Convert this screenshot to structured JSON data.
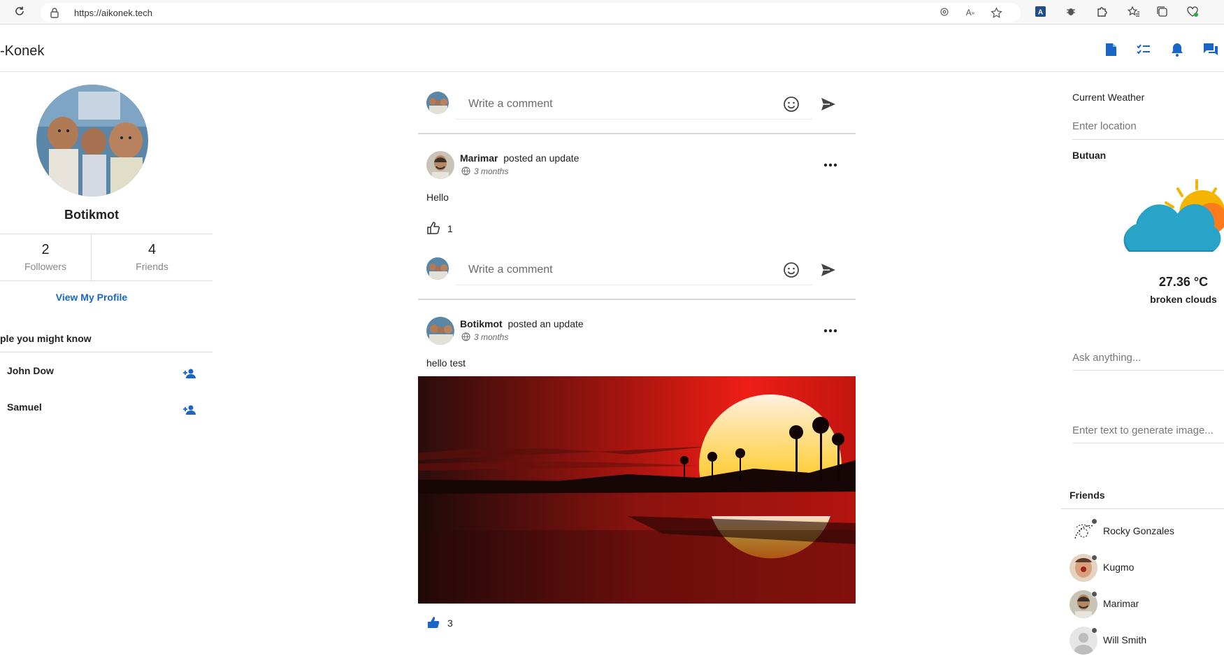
{
  "browser": {
    "url": "https://aikonek.tech",
    "icons": [
      "reload-icon",
      "lock-icon",
      "location-icon",
      "read-aloud-icon",
      "favorite-star-icon",
      "extension-icon",
      "bug-icon",
      "puzzle-icon",
      "favorites-icon",
      "collections-icon",
      "performance-icon"
    ]
  },
  "app": {
    "brand": "-Konek",
    "header_icons": [
      "document-icon",
      "task-list-icon",
      "bell-icon",
      "chat-icon"
    ],
    "accent": "#1a66c8"
  },
  "profile": {
    "name": "Botikmot",
    "followers_count": "2",
    "followers_label": "Followers",
    "friends_count": "4",
    "friends_label": "Friends",
    "view_profile": "View My Profile"
  },
  "pymk": {
    "title": "ple you might know",
    "people": [
      {
        "name": "John Dow"
      },
      {
        "name": "Samuel"
      }
    ]
  },
  "feed": {
    "comment_placeholder": "Write a comment",
    "posts": [
      {
        "author": "Marimar",
        "action": "posted an update",
        "time": "3 months",
        "text": "Hello",
        "likes": "1"
      },
      {
        "author": "Botikmot",
        "action": "posted an update",
        "time": "3 months",
        "text": "hello test",
        "likes": "3"
      }
    ]
  },
  "sidebar": {
    "weather_title": "Current Weather",
    "location_placeholder": "Enter location",
    "city": "Butuan",
    "temperature": "27.36 °C",
    "description": "broken clouds",
    "ask_placeholder": "Ask anything...",
    "generate_placeholder": "Enter text to generate image...",
    "friends_title": "Friends",
    "friends": [
      {
        "name": "Rocky Gonzales"
      },
      {
        "name": "Kugmo"
      },
      {
        "name": "Marimar"
      },
      {
        "name": "Will Smith"
      }
    ]
  }
}
